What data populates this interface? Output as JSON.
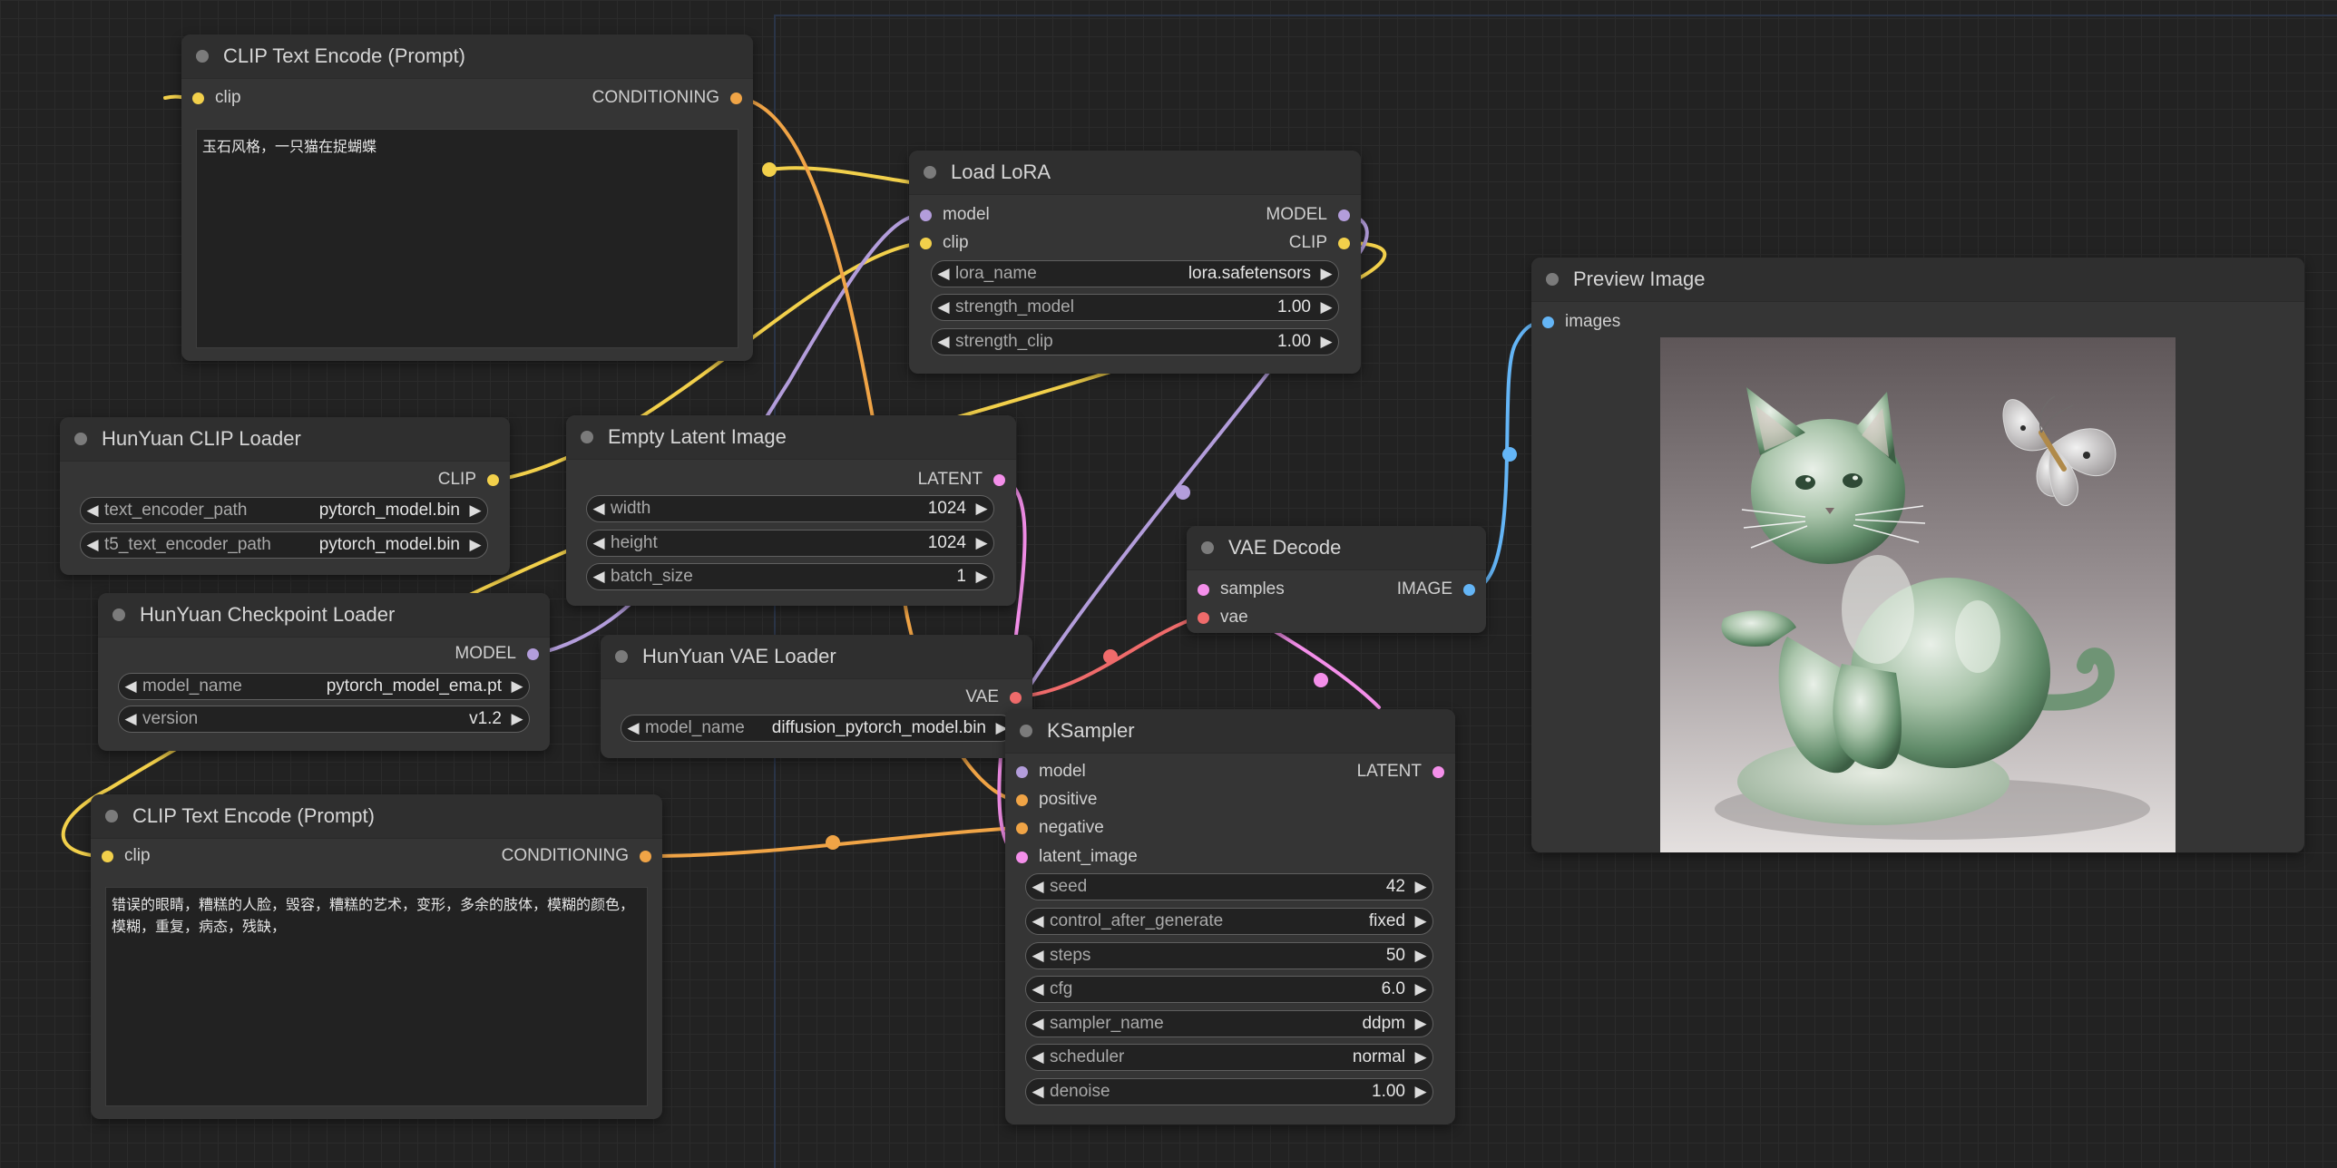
{
  "colors": {
    "clip": "#f2d04b",
    "conditioning": "#f0a446",
    "model": "#b39ddb",
    "latent": "#f48fea",
    "vae": "#ef6b6b",
    "image": "#64b5f6",
    "node_bg": "#353535",
    "node_title": "#2f2f2f"
  },
  "nodes": {
    "clip_text_encode_positive": {
      "title": "CLIP Text Encode (Prompt)",
      "input_clip": "clip",
      "output_conditioning": "CONDITIONING",
      "text": "玉石风格，一只猫在捉蝴蝶"
    },
    "load_lora": {
      "title": "Load LoRA",
      "input_model": "model",
      "input_clip": "clip",
      "output_model": "MODEL",
      "output_clip": "CLIP",
      "widgets": [
        {
          "label": "lora_name",
          "value": "lora.safetensors"
        },
        {
          "label": "strength_model",
          "value": "1.00"
        },
        {
          "label": "strength_clip",
          "value": "1.00"
        }
      ]
    },
    "preview_image": {
      "title": "Preview Image",
      "input_images": "images"
    },
    "hunyuan_clip_loader": {
      "title": "HunYuan CLIP Loader",
      "output_clip": "CLIP",
      "widgets": [
        {
          "label": "text_encoder_path",
          "value": "pytorch_model.bin"
        },
        {
          "label": "t5_text_encoder_path",
          "value": "pytorch_model.bin"
        }
      ]
    },
    "empty_latent_image": {
      "title": "Empty Latent Image",
      "output_latent": "LATENT",
      "widgets": [
        {
          "label": "width",
          "value": "1024"
        },
        {
          "label": "height",
          "value": "1024"
        },
        {
          "label": "batch_size",
          "value": "1"
        }
      ]
    },
    "vae_decode": {
      "title": "VAE Decode",
      "input_samples": "samples",
      "input_vae": "vae",
      "output_image": "IMAGE"
    },
    "hunyuan_checkpoint_loader": {
      "title": "HunYuan Checkpoint Loader",
      "output_model": "MODEL",
      "widgets": [
        {
          "label": "model_name",
          "value": "pytorch_model_ema.pt"
        },
        {
          "label": "version",
          "value": "v1.2"
        }
      ]
    },
    "hunyuan_vae_loader": {
      "title": "HunYuan VAE Loader",
      "output_vae": "VAE",
      "widgets": [
        {
          "label": "model_name",
          "value": "diffusion_pytorch_model.bin"
        }
      ]
    },
    "ksampler": {
      "title": "KSampler",
      "input_model": "model",
      "input_positive": "positive",
      "input_negative": "negative",
      "input_latent_image": "latent_image",
      "output_latent": "LATENT",
      "widgets": [
        {
          "label": "seed",
          "value": "42"
        },
        {
          "label": "control_after_generate",
          "value": "fixed"
        },
        {
          "label": "steps",
          "value": "50"
        },
        {
          "label": "cfg",
          "value": "6.0"
        },
        {
          "label": "sampler_name",
          "value": "ddpm"
        },
        {
          "label": "scheduler",
          "value": "normal"
        },
        {
          "label": "denoise",
          "value": "1.00"
        }
      ]
    },
    "clip_text_encode_negative": {
      "title": "CLIP Text Encode (Prompt)",
      "input_clip": "clip",
      "output_conditioning": "CONDITIONING",
      "text": "错误的眼睛，糟糕的人脸，毁容，糟糕的艺术，变形，多余的肢体，模糊的颜色，模糊，重复，病态，残缺，"
    }
  }
}
